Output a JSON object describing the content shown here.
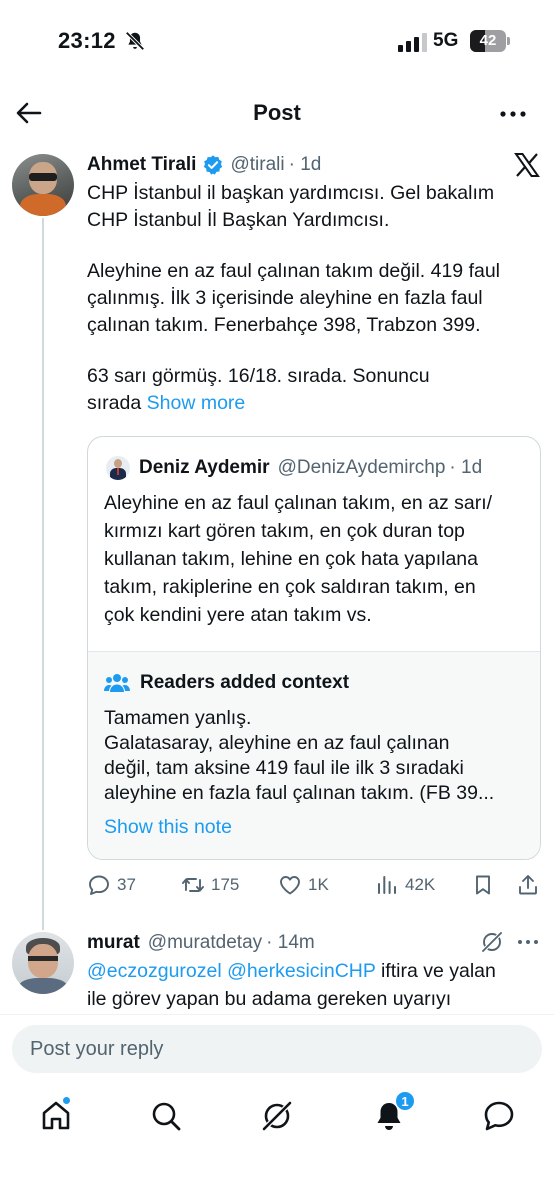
{
  "status_bar": {
    "time": "23:12",
    "network": "5G",
    "battery": "42",
    "battery_level": 0.42,
    "icons": [
      "bell-slash-icon",
      "signal-bars-icon",
      "battery-icon"
    ]
  },
  "header": {
    "title": "Post",
    "back_icon": "arrow-left-icon",
    "more_icon": "ellipsis-icon"
  },
  "post": {
    "author": {
      "display_name": "Ahmet Tirali",
      "handle": "@tirali",
      "time": "· 1d",
      "verified": true
    },
    "lines": [
      "CHP İstanbul il başkan yardımcısı. Gel bakalım",
      "CHP İstanbul İl Başkan Yardımcısı.",
      "Aleyhine en az faul çalınan takım değil. 419 faul",
      "çalınmış. İlk 3 içerisinde aleyhine en fazla faul",
      "çalınan takım. Fenerbahçe 398, Trabzon 399.",
      "63 sarı görmüş. 16/18. sırada. Sonuncu",
      "sırada"
    ],
    "show_more": "Show more",
    "quote": {
      "display_name": "Deniz Aydemir",
      "handle": "@DenizAydemirchp",
      "time": "· 1d",
      "lines": [
        "Aleyhine en az faul çalınan takım, en az sarı/",
        "kırmızı kart gören takım, en çok duran top",
        "kullanan takım, lehine en çok hata yapılana",
        "takım, rakiplerine en çok saldıran takım, en",
        "çok kendini yere atan takım vs."
      ]
    },
    "community_note": {
      "title": "Readers added context",
      "lines": [
        "Tamamen yanlış.",
        "Galatasaray, aleyhine en az faul çalınan",
        "değil, tam aksine 419 faul ile ilk 3 sıradaki",
        "aleyhine en fazla faul çalınan takım. (FB 39..."
      ],
      "link": "Show this note"
    },
    "actions": {
      "replies": "37",
      "reposts": "175",
      "likes": "1K",
      "views": "42K"
    }
  },
  "reply": {
    "display_name": "murat",
    "handle": "@muratdetay",
    "time": "· 14m",
    "mention_1": "@eczozgurozel",
    "mention_2": "@herkesicinCHP",
    "text_1": " iftira ve yalan",
    "text_2": "ile görev yapan bu adama gereken uyarıyı"
  },
  "composer": {
    "placeholder": "Post your reply"
  },
  "bottom_nav": {
    "items": [
      "home-icon",
      "search-icon",
      "grok-icon",
      "notifications-icon",
      "messages-icon"
    ],
    "notification_count": "1"
  },
  "colors": {
    "accent": "#1d9bf0",
    "text": "#0f1419",
    "muted": "#536471",
    "border": "#cfd9de"
  }
}
